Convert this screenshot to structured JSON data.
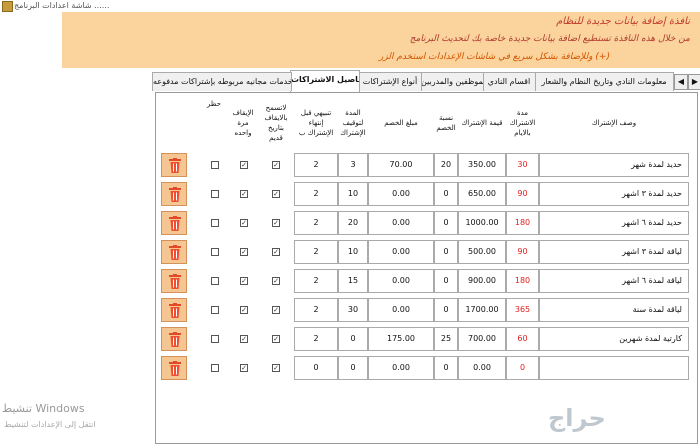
{
  "window": {
    "title": "شاشة اعدادات البرنامج ......"
  },
  "header": {
    "line1": "نافذة إضافة بيانات جديدة للنظام",
    "line2": "من خلال هذه النافذة تستطيع اضافة بيانات جديدة خاصة بك لتحديث البرنامج",
    "line3": "وللإضافة بشكل سريع في شاشات الإعدادات استخدم الزر (+)"
  },
  "watermark": {
    "line1": "تنشيط Windows",
    "line2": "انتقل إلى الإعدادات لتنشيط"
  },
  "tabs": [
    "معلومات النادي وتاريخ النظام والشعار",
    "اقسام النادي",
    "الموظفين والمدربين",
    "أنواع الإشتراكات",
    "تفاصيل الاشتراكات",
    "خدمات مجانيه مربوطه بإشتراكات مدفوعه"
  ],
  "columns": {
    "desc": "وصف الإشتراك",
    "days": "مدة الاشتراك بالايام",
    "price": "قيمة الإشتراك",
    "discount_pct": "نسبة الخصم",
    "discount_amt": "مبلغ الخصم",
    "freeze": "المدة لتوقيف الإشتراك",
    "notify": "تنبيهي قبل إنتهاء الإشتراك ب",
    "no_renew": "لاتسمح بالايقاف بتاريخ قديم",
    "once": "الإيقاف مرة واحده",
    "block": "حظر"
  },
  "rows": [
    {
      "desc": "حديد لمدة شهر",
      "days": "30",
      "price": "350.00",
      "discount_pct": "20",
      "discount_amt": "70.00",
      "freeze": "3",
      "notify": "2",
      "c1": true,
      "c2": true,
      "c3": false
    },
    {
      "desc": "حديد لمدة ٣ اشهر",
      "days": "90",
      "price": "650.00",
      "discount_pct": "0",
      "discount_amt": "0.00",
      "freeze": "10",
      "notify": "2",
      "c1": true,
      "c2": true,
      "c3": false
    },
    {
      "desc": "حديد لمدة ٦ اشهر",
      "days": "180",
      "price": "1000.00",
      "discount_pct": "0",
      "discount_amt": "0.00",
      "freeze": "20",
      "notify": "2",
      "c1": true,
      "c2": true,
      "c3": false
    },
    {
      "desc": "لياقة لمدة ٣ اشهر",
      "days": "90",
      "price": "500.00",
      "discount_pct": "0",
      "discount_amt": "0.00",
      "freeze": "10",
      "notify": "2",
      "c1": true,
      "c2": true,
      "c3": false
    },
    {
      "desc": "لياقة لمدة ٦ اشهر",
      "days": "180",
      "price": "900.00",
      "discount_pct": "0",
      "discount_amt": "0.00",
      "freeze": "15",
      "notify": "2",
      "c1": true,
      "c2": true,
      "c3": false
    },
    {
      "desc": "لياقة لمدة سنة",
      "days": "365",
      "price": "1700.00",
      "discount_pct": "0",
      "discount_amt": "0.00",
      "freeze": "30",
      "notify": "2",
      "c1": true,
      "c2": true,
      "c3": false
    },
    {
      "desc": "كارتية لمدة شهرين",
      "days": "60",
      "price": "700.00",
      "discount_pct": "25",
      "discount_amt": "175.00",
      "freeze": "0",
      "notify": "2",
      "c1": true,
      "c2": true,
      "c3": false
    },
    {
      "desc": "",
      "days": "0",
      "price": "0.00",
      "discount_pct": "0",
      "discount_amt": "0.00",
      "freeze": "0",
      "notify": "0",
      "c1": true,
      "c2": true,
      "c3": false
    }
  ],
  "logo": {
    "text": "حراج"
  },
  "icons": {
    "delete": "trash-icon",
    "prev": "arrow-left-icon",
    "next": "arrow-right-icon"
  },
  "colors": {
    "header_bg": "#fbd39c",
    "days_red": "#e02020",
    "delete_bg": "#f5c592"
  }
}
